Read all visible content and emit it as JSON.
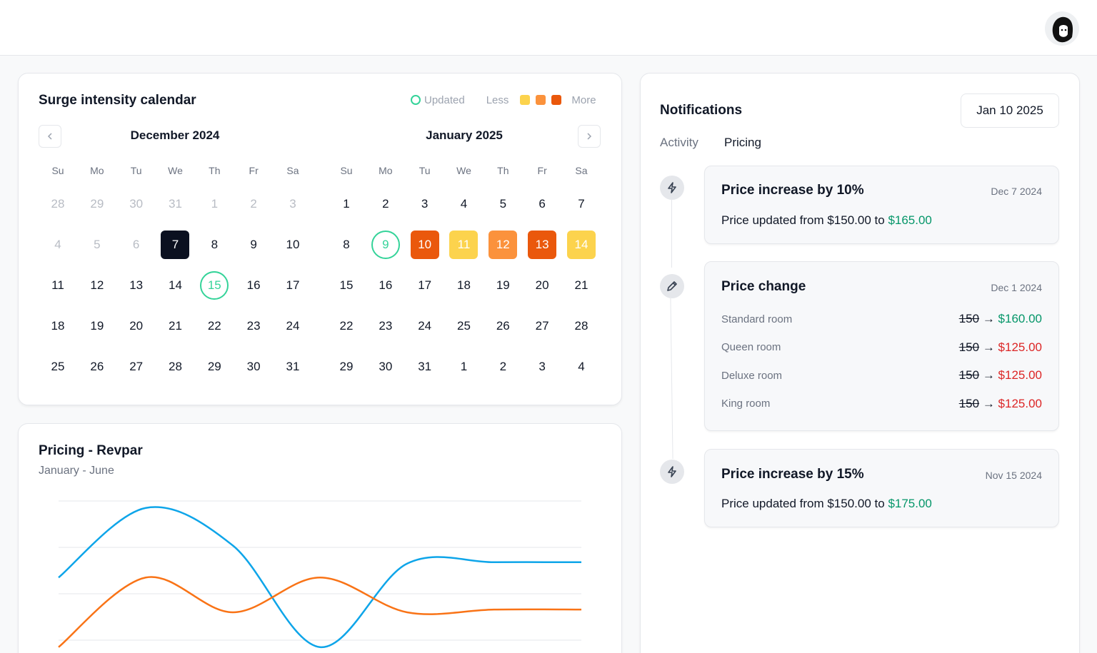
{
  "header": {
    "avatar_icon": "user-avatar-icon"
  },
  "calendar": {
    "title": "Surge intensity calendar",
    "legend": {
      "updated": "Updated",
      "less": "Less",
      "more": "More",
      "colors": [
        "#fcd34d",
        "#fb923c",
        "#ea580c"
      ]
    },
    "weekdays": [
      "Su",
      "Mo",
      "Tu",
      "We",
      "Th",
      "Fr",
      "Sa"
    ],
    "months": [
      {
        "title": "December 2024",
        "weeks": [
          [
            {
              "d": "28",
              "m": 1
            },
            {
              "d": "29",
              "m": 1
            },
            {
              "d": "30",
              "m": 1
            },
            {
              "d": "31",
              "m": 1
            },
            {
              "d": "1",
              "m": 1
            },
            {
              "d": "2",
              "m": 1
            },
            {
              "d": "3",
              "m": 1
            }
          ],
          [
            {
              "d": "4",
              "m": 1
            },
            {
              "d": "5",
              "m": 1
            },
            {
              "d": "6",
              "m": 1
            },
            {
              "d": "7",
              "s": "sel"
            },
            {
              "d": "8"
            },
            {
              "d": "9"
            },
            {
              "d": "10"
            }
          ],
          [
            {
              "d": "11"
            },
            {
              "d": "12"
            },
            {
              "d": "13"
            },
            {
              "d": "14"
            },
            {
              "d": "15",
              "s": "upd"
            },
            {
              "d": "16"
            },
            {
              "d": "17"
            }
          ],
          [
            {
              "d": "18"
            },
            {
              "d": "19"
            },
            {
              "d": "20"
            },
            {
              "d": "21"
            },
            {
              "d": "22"
            },
            {
              "d": "23"
            },
            {
              "d": "24"
            }
          ],
          [
            {
              "d": "25"
            },
            {
              "d": "26"
            },
            {
              "d": "27"
            },
            {
              "d": "28"
            },
            {
              "d": "29"
            },
            {
              "d": "30"
            },
            {
              "d": "31"
            }
          ]
        ]
      },
      {
        "title": "January 2025",
        "weeks": [
          [
            {
              "d": "1"
            },
            {
              "d": "2"
            },
            {
              "d": "3"
            },
            {
              "d": "4"
            },
            {
              "d": "5"
            },
            {
              "d": "6"
            },
            {
              "d": "7"
            }
          ],
          [
            {
              "d": "8"
            },
            {
              "d": "9",
              "s": "upd"
            },
            {
              "d": "10",
              "s": "s3"
            },
            {
              "d": "11",
              "s": "s1"
            },
            {
              "d": "12",
              "s": "s2"
            },
            {
              "d": "13",
              "s": "s3"
            },
            {
              "d": "14",
              "s": "s1"
            }
          ],
          [
            {
              "d": "15"
            },
            {
              "d": "16"
            },
            {
              "d": "17"
            },
            {
              "d": "18"
            },
            {
              "d": "19"
            },
            {
              "d": "20"
            },
            {
              "d": "21"
            }
          ],
          [
            {
              "d": "22"
            },
            {
              "d": "23"
            },
            {
              "d": "24"
            },
            {
              "d": "25"
            },
            {
              "d": "26"
            },
            {
              "d": "27"
            },
            {
              "d": "28"
            }
          ],
          [
            {
              "d": "29"
            },
            {
              "d": "30"
            },
            {
              "d": "31"
            },
            {
              "d": "1"
            },
            {
              "d": "2"
            },
            {
              "d": "3"
            },
            {
              "d": "4"
            }
          ]
        ]
      }
    ]
  },
  "chart": {
    "title": "Pricing - Revpar",
    "subtitle": "January - June"
  },
  "chart_data": {
    "type": "line",
    "title": "Pricing - Revpar",
    "subtitle": "January - June",
    "x": [
      0,
      1,
      2,
      3,
      4,
      5,
      6
    ],
    "grid": true,
    "ylim": [
      0,
      100
    ],
    "series": [
      {
        "color": "#0ea5e9",
        "values": [
          45,
          95,
          68,
          -5,
          55,
          56,
          56
        ]
      },
      {
        "color": "#f97316",
        "values": [
          -5,
          45,
          20,
          45,
          20,
          22,
          22
        ]
      }
    ]
  },
  "notifications": {
    "title": "Notifications",
    "date_button": "Jan 10 2025",
    "tabs": [
      "Activity",
      "Pricing"
    ],
    "items": [
      {
        "title": "Price increase by 10%",
        "date": "Dec 7 2024",
        "body_prefix": "Price updated from $150.00 to ",
        "body_value": "$165.00",
        "icon": "lightning-icon"
      },
      {
        "title": "Price change",
        "date": "Dec 1 2024",
        "icon": "pencil-icon",
        "rooms": [
          {
            "name": "Standard room",
            "old": "150",
            "arrow": "→",
            "new": "$160.00",
            "dir": "up"
          },
          {
            "name": "Queen room",
            "old": "150",
            "arrow": "→",
            "new": "$125.00",
            "dir": "down"
          },
          {
            "name": "Deluxe room",
            "old": "150",
            "arrow": "→",
            "new": "$125.00",
            "dir": "down"
          },
          {
            "name": "King room",
            "old": "150",
            "arrow": "→",
            "new": "$125.00",
            "dir": "down"
          }
        ]
      },
      {
        "title": "Price increase by 15%",
        "date": "Nov 15 2024",
        "body_prefix": "Price updated from $150.00 to ",
        "body_value": "$175.00",
        "icon": "lightning-icon"
      }
    ]
  }
}
